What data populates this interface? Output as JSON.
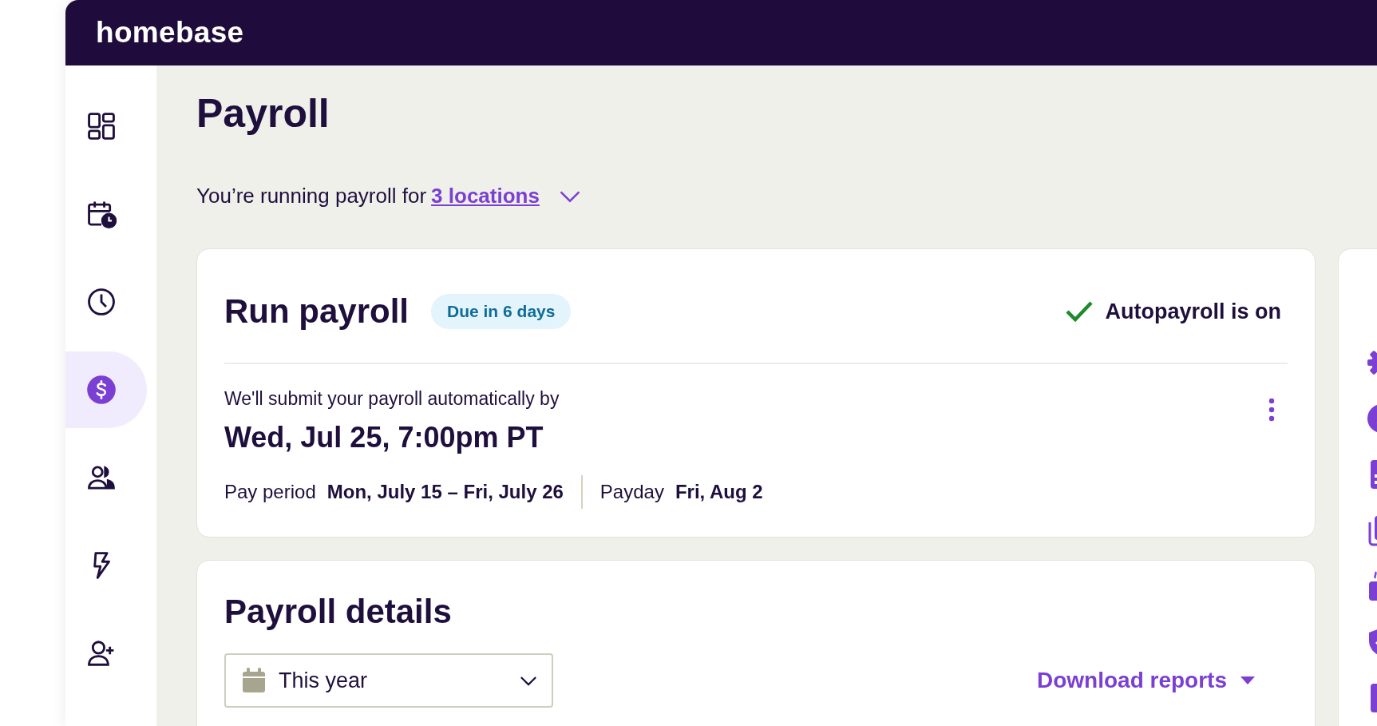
{
  "header": {
    "logo": "homebase"
  },
  "sidebar": {
    "items": [
      {
        "selected": false
      },
      {
        "selected": false
      },
      {
        "selected": false
      },
      {
        "selected": true
      },
      {
        "selected": false
      },
      {
        "selected": false
      },
      {
        "selected": false
      }
    ]
  },
  "page": {
    "title": "Payroll",
    "subtitle": "You’re running payroll for",
    "locations_link": "3 locations"
  },
  "run_payroll": {
    "title": "Run payroll",
    "badge": "Due in 6 days",
    "autopayroll": {
      "label": "Autopayroll is on",
      "on": true
    },
    "note": "We'll submit your payroll automatically by",
    "deadline": "Wed, Jul 25, 7:00pm PT",
    "pay_period_label": "Pay period",
    "pay_period": "Mon, July 15 – Fri, July 26",
    "payday_label": "Payday",
    "payday": "Fri, Aug 2"
  },
  "payroll_details": {
    "title": "Payroll details",
    "period_select": {
      "value": "This year"
    },
    "download_link": "Download reports"
  }
}
